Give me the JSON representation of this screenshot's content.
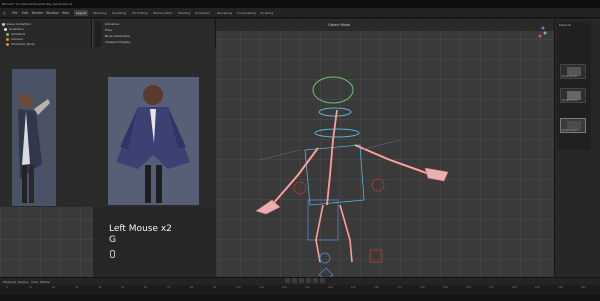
{
  "window": {
    "title": "Blender* [C:\\Users\\Character\\Rig_Setup.blend]"
  },
  "menu": {
    "items": [
      "File",
      "Edit",
      "Render",
      "Window",
      "Help"
    ],
    "workspaces": [
      "Layout",
      "Modeling",
      "Sculpting",
      "UV Editing",
      "Texture Paint",
      "Shading",
      "Animation",
      "Rendering",
      "Compositing",
      "Scripting"
    ],
    "active_workspace": "Layout"
  },
  "outliner": {
    "rows": [
      "Scene Collection",
      "Collection",
      "Armature",
      "Camera",
      "Character_Body"
    ]
  },
  "properties": {
    "rows": [
      "Armature",
      "Pose",
      "Bone Collections",
      "Viewport Display"
    ]
  },
  "viewport": {
    "header_label": "Object Mode"
  },
  "key_overlay": {
    "line1": "Left Mouse x2",
    "line2": "G"
  },
  "material_list": {
    "header": "Material",
    "items": [
      "Material.001",
      "Material.002",
      "Material.003"
    ]
  },
  "timeline": {
    "menus": [
      "Playback",
      "Keying",
      "View",
      "Marker"
    ],
    "ticks": [
      "0",
      "10",
      "20",
      "30",
      "40",
      "50",
      "60",
      "70",
      "80",
      "90",
      "100",
      "110",
      "120",
      "130",
      "140",
      "150",
      "160",
      "170",
      "180",
      "190",
      "200",
      "210",
      "220",
      "230",
      "240",
      "250"
    ]
  },
  "colors": {
    "bone": "#ff9d9d",
    "bone_outline": "#d97070",
    "control_cyan": "#55b6d3",
    "control_blue": "#5b7fd8",
    "control_red": "#c0392b",
    "control_green": "#6fbf73",
    "control_orange": "#e08a3a"
  }
}
